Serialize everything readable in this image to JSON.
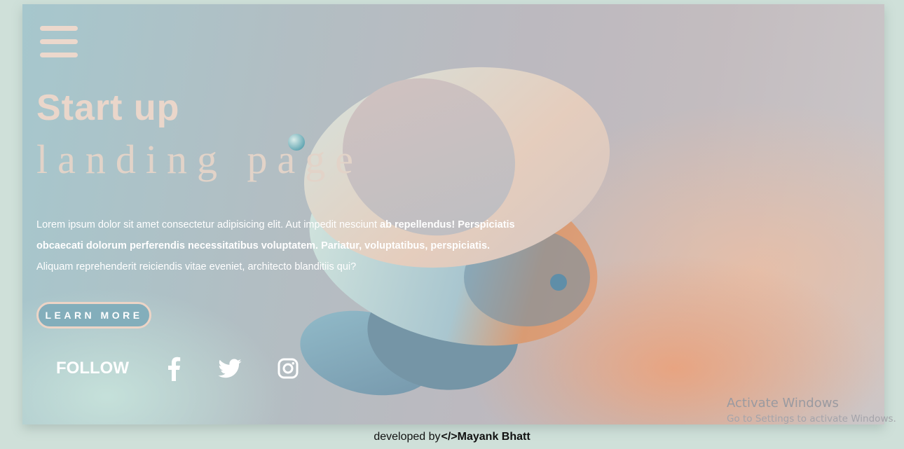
{
  "hero": {
    "title_line1": "Start up",
    "title_line2": "landing page",
    "description_plain_1": "Lorem ipsum dolor sit amet consectetur adipisicing elit. Aut impedit nesciunt ",
    "description_bold": "ab repellendus! Perspiciatis obcaecati dolorum perferendis necessitatibus voluptatem. Pariatur, voluptatibus, perspiciatis.",
    "description_plain_2": " Aliquam reprehenderit reiciendis vitae eveniet, architecto blanditiis qui?",
    "cta_label": "LEARN MORE"
  },
  "menu": {
    "icon": "hamburger-menu-icon"
  },
  "social": {
    "label": "FOLLOW",
    "icons": [
      "facebook-icon",
      "twitter-icon",
      "instagram-icon"
    ]
  },
  "watermark": {
    "title": "Activate Windows",
    "subtitle": "Go to Settings to activate Windows."
  },
  "footer": {
    "prefix": "developed by",
    "code_symbol": "</>",
    "author": "Mayank Bhatt"
  },
  "colors": {
    "heading": "#ead6ca",
    "button_bg": "#83aebb",
    "button_border": "#ecd4c6",
    "page_bg": "#cfe0d9"
  }
}
